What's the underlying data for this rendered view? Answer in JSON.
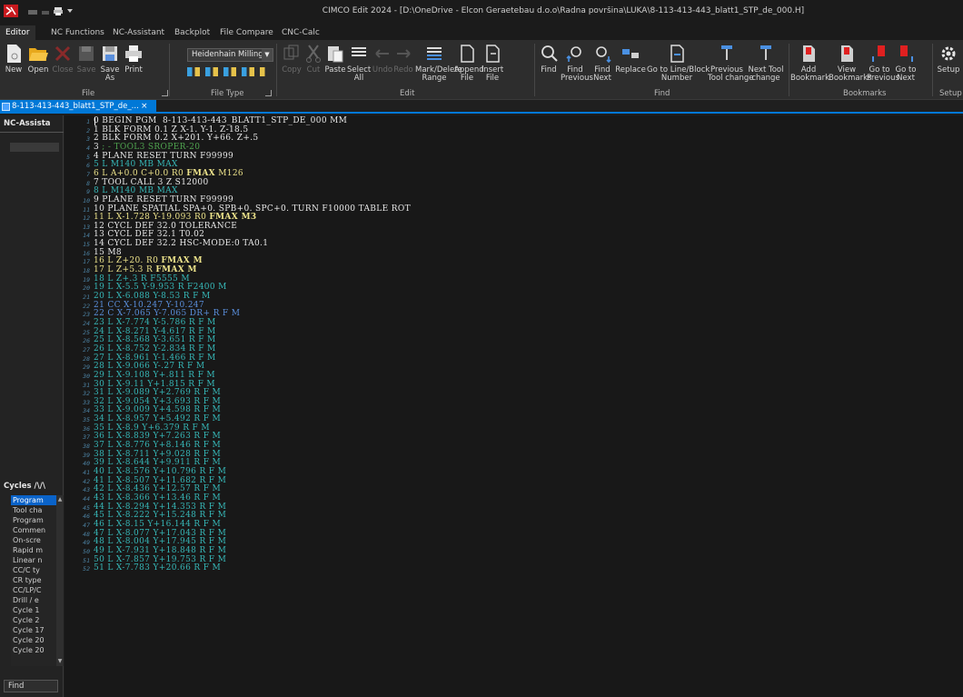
{
  "window": {
    "title": "CIMCO Edit 2024 - [D:\\OneDrive - Elcon Geraetebau d.o.o\\Radna površina\\LUKA\\8-113-413-443_blatt1_STP_de_000.H]"
  },
  "ribbon_tabs": [
    "Editor",
    "NC Functions",
    "NC-Assistant",
    "Backplot",
    "File Compare",
    "CNC-Calc"
  ],
  "ribbon": {
    "buttons": [
      {
        "name": "new",
        "label": "New",
        "enabled": true
      },
      {
        "name": "open",
        "label": "Open",
        "enabled": true
      },
      {
        "name": "close",
        "label": "Close",
        "enabled": false
      },
      {
        "name": "save",
        "label": "Save",
        "enabled": false
      },
      {
        "name": "save-as",
        "label": "Save\nAs",
        "enabled": true
      },
      {
        "name": "print",
        "label": "Print",
        "enabled": true
      },
      {
        "name": "copy",
        "label": "Copy",
        "enabled": false
      },
      {
        "name": "cut",
        "label": "Cut",
        "enabled": false
      },
      {
        "name": "paste",
        "label": "Paste",
        "enabled": true
      },
      {
        "name": "select-all",
        "label": "Select\nAll",
        "enabled": true
      },
      {
        "name": "undo",
        "label": "Undo",
        "enabled": false
      },
      {
        "name": "redo",
        "label": "Redo",
        "enabled": false
      },
      {
        "name": "mark-delete-range",
        "label": "Mark/Delete\nRange",
        "enabled": true
      },
      {
        "name": "append-file",
        "label": "Append\nFile",
        "enabled": true
      },
      {
        "name": "insert-file",
        "label": "Insert\nFile",
        "enabled": true
      },
      {
        "name": "find",
        "label": "Find",
        "enabled": true
      },
      {
        "name": "find-previous",
        "label": "Find\nPrevious",
        "enabled": true
      },
      {
        "name": "find-next",
        "label": "Find\nNext",
        "enabled": true
      },
      {
        "name": "replace",
        "label": "Replace",
        "enabled": true
      },
      {
        "name": "goto-line",
        "label": "Go to Line/Block\nNumber",
        "enabled": true
      },
      {
        "name": "prev-tool-change",
        "label": "Previous\nTool change",
        "enabled": true
      },
      {
        "name": "next-tool-change",
        "label": "Next Tool\nchange",
        "enabled": true
      },
      {
        "name": "add-bookmark",
        "label": "Add\nBookmark",
        "enabled": true
      },
      {
        "name": "view-bookmarks",
        "label": "View\nBookmarks",
        "enabled": true
      },
      {
        "name": "goto-previous",
        "label": "Go to\nPrevious",
        "enabled": true
      },
      {
        "name": "goto-next",
        "label": "Go to\nNext",
        "enabled": true
      },
      {
        "name": "setup",
        "label": "Setup",
        "enabled": true
      }
    ],
    "groups": [
      {
        "name": "file",
        "label": "File"
      },
      {
        "name": "file-type",
        "label": "File Type"
      },
      {
        "name": "edit",
        "label": "Edit"
      },
      {
        "name": "find",
        "label": "Find"
      },
      {
        "name": "bookmarks",
        "label": "Bookmarks"
      },
      {
        "name": "setup",
        "label": "Setup"
      }
    ],
    "file_type_value": "Heidenhain Milling"
  },
  "document_tab": {
    "label": "8-113-413-443_blatt1_STP_de_...",
    "close": "×"
  },
  "left_panel": {
    "title": "NC-Assista",
    "cycles_title": "Cycles /\\/\\",
    "cycles": [
      "Program",
      "Tool cha",
      "Program",
      "Commen",
      "On-scre",
      "Rapid m",
      "Linear n",
      "CC/C ty",
      "CR type",
      "CC/LP/C",
      "Drill / e",
      "Cycle 1",
      "Cycle 2",
      "Cycle 17",
      "Cycle 20",
      "Cycle 20"
    ],
    "find_label": "Find"
  },
  "colors": {
    "white": "#e8e8e8",
    "yellow": "#ece28a",
    "teal": "#36b7b7",
    "blue": "#5a8fdc",
    "green": "#4fa34f",
    "gutter": "#4c82a3",
    "accent": "#0078d7"
  },
  "code_lines": [
    [
      {
        "t": "0 BEGIN PGM  8-113-413-443_BLATT1_STP_DE_000 MM",
        "c": "white"
      }
    ],
    [
      {
        "t": "1 BLK FORM 0.1 Z X-1. Y-1. Z-18.5",
        "c": "white"
      }
    ],
    [
      {
        "t": "2 BLK FORM 0.2 X+201. Y+66. Z+.5",
        "c": "white"
      }
    ],
    [
      {
        "t": "3 ",
        "c": "white"
      },
      {
        "t": "; - TOOL3 SROPER-20",
        "c": "green"
      }
    ],
    [
      {
        "t": "4 PLANE RESET TURN F99999",
        "c": "white"
      }
    ],
    [
      {
        "t": "5 L M140 MB MAX",
        "c": "teal"
      }
    ],
    [
      {
        "t": "6 L A+0.0 C+0.0 R0 ",
        "c": "yellow"
      },
      {
        "t": "FMAX",
        "c": "yellow",
        "b": true
      },
      {
        "t": " M126",
        "c": "yellow"
      }
    ],
    [
      {
        "t": "7 TOOL CALL 3 Z S12000",
        "c": "white"
      }
    ],
    [
      {
        "t": "8 L M140 MB MAX",
        "c": "teal"
      }
    ],
    [
      {
        "t": "9 PLANE RESET TURN F99999",
        "c": "white"
      }
    ],
    [
      {
        "t": "10 PLANE SPATIAL SPA+0. SPB+0. SPC+0. TURN F10000 TABLE ROT",
        "c": "white"
      }
    ],
    [
      {
        "t": "11 L X-1.728 Y-19.093 R0 ",
        "c": "yellow"
      },
      {
        "t": "FMAX M3",
        "c": "yellow",
        "b": true
      }
    ],
    [
      {
        "t": "12 CYCL DEF 32.0 TOLERANCE",
        "c": "white"
      }
    ],
    [
      {
        "t": "13 CYCL DEF 32.1 T0.02",
        "c": "white"
      }
    ],
    [
      {
        "t": "14 CYCL DEF 32.2 HSC-MODE:0 TA0.1",
        "c": "white"
      }
    ],
    [
      {
        "t": "15 M8",
        "c": "white"
      }
    ],
    [
      {
        "t": "16 L Z+20. R0 ",
        "c": "yellow"
      },
      {
        "t": "FMAX M",
        "c": "yellow",
        "b": true
      }
    ],
    [
      {
        "t": "17 L Z+5.3 R ",
        "c": "yellow"
      },
      {
        "t": "FMAX M",
        "c": "yellow",
        "b": true
      }
    ],
    [
      {
        "t": "18 L Z+.3 R F5555 M",
        "c": "teal"
      }
    ],
    [
      {
        "t": "19 L X-5.5 Y-9.953 R F2400 M",
        "c": "teal"
      }
    ],
    [
      {
        "t": "20 L X-6.088 Y-8.53 R F M",
        "c": "teal"
      }
    ],
    [
      {
        "t": "21 CC X-10.247 Y-10.247",
        "c": "blue"
      }
    ],
    [
      {
        "t": "22 C X-7.065 Y-7.065 DR+ R F M",
        "c": "blue"
      }
    ],
    [
      {
        "t": "23 L X-7.774 Y-5.786 R F M",
        "c": "teal"
      }
    ],
    [
      {
        "t": "24 L X-8.271 Y-4.617 R F M",
        "c": "teal"
      }
    ],
    [
      {
        "t": "25 L X-8.568 Y-3.651 R F M",
        "c": "teal"
      }
    ],
    [
      {
        "t": "26 L X-8.752 Y-2.834 R F M",
        "c": "teal"
      }
    ],
    [
      {
        "t": "27 L X-8.961 Y-1.466 R F M",
        "c": "teal"
      }
    ],
    [
      {
        "t": "28 L X-9.066 Y-.27 R F M",
        "c": "teal"
      }
    ],
    [
      {
        "t": "29 L X-9.108 Y+.811 R F M",
        "c": "teal"
      }
    ],
    [
      {
        "t": "30 L X-9.11 Y+1.815 R F M",
        "c": "teal"
      }
    ],
    [
      {
        "t": "31 L X-9.089 Y+2.769 R F M",
        "c": "teal"
      }
    ],
    [
      {
        "t": "32 L X-9.054 Y+3.693 R F M",
        "c": "teal"
      }
    ],
    [
      {
        "t": "33 L X-9.009 Y+4.598 R F M",
        "c": "teal"
      }
    ],
    [
      {
        "t": "34 L X-8.957 Y+5.492 R F M",
        "c": "teal"
      }
    ],
    [
      {
        "t": "35 L X-8.9 Y+6.379 R F M",
        "c": "teal"
      }
    ],
    [
      {
        "t": "36 L X-8.839 Y+7.263 R F M",
        "c": "teal"
      }
    ],
    [
      {
        "t": "37 L X-8.776 Y+8.146 R F M",
        "c": "teal"
      }
    ],
    [
      {
        "t": "38 L X-8.711 Y+9.028 R F M",
        "c": "teal"
      }
    ],
    [
      {
        "t": "39 L X-8.644 Y+9.911 R F M",
        "c": "teal"
      }
    ],
    [
      {
        "t": "40 L X-8.576 Y+10.796 R F M",
        "c": "teal"
      }
    ],
    [
      {
        "t": "41 L X-8.507 Y+11.682 R F M",
        "c": "teal"
      }
    ],
    [
      {
        "t": "42 L X-8.436 Y+12.57 R F M",
        "c": "teal"
      }
    ],
    [
      {
        "t": "43 L X-8.366 Y+13.46 R F M",
        "c": "teal"
      }
    ],
    [
      {
        "t": "44 L X-8.294 Y+14.353 R F M",
        "c": "teal"
      }
    ],
    [
      {
        "t": "45 L X-8.222 Y+15.248 R F M",
        "c": "teal"
      }
    ],
    [
      {
        "t": "46 L X-8.15 Y+16.144 R F M",
        "c": "teal"
      }
    ],
    [
      {
        "t": "47 L X-8.077 Y+17.043 R F M",
        "c": "teal"
      }
    ],
    [
      {
        "t": "48 L X-8.004 Y+17.945 R F M",
        "c": "teal"
      }
    ],
    [
      {
        "t": "49 L X-7.931 Y+18.848 R F M",
        "c": "teal"
      }
    ],
    [
      {
        "t": "50 L X-7.857 Y+19.753 R F M",
        "c": "teal"
      }
    ],
    [
      {
        "t": "51 L X-7.783 Y+20.66 R F M",
        "c": "teal"
      }
    ]
  ]
}
